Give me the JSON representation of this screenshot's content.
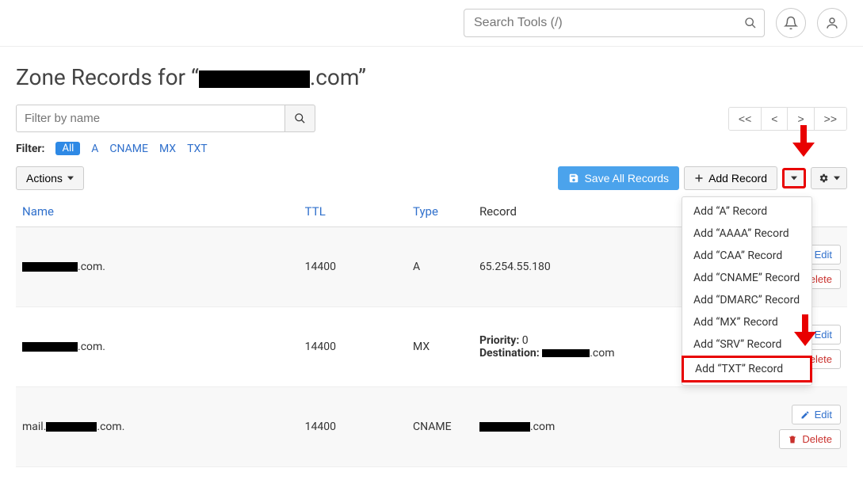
{
  "topbar": {
    "search_placeholder": "Search Tools (/)"
  },
  "title_prefix": "Zone Records for “",
  "title_domain_suffix": ".com",
  "title_close": "”",
  "filter_placeholder": "Filter by name",
  "pager": {
    "first": "<<",
    "prev": "<",
    "next": ">",
    "last": ">>"
  },
  "filters": {
    "label": "Filter:",
    "all": "All",
    "items": [
      "A",
      "CNAME",
      "MX",
      "TXT"
    ]
  },
  "actions_label": "Actions",
  "save_all": "Save All Records",
  "add_record": "Add Record",
  "columns": {
    "name": "Name",
    "ttl": "TTL",
    "type": "Type",
    "record": "Record"
  },
  "rows": [
    {
      "name_suffix": ".com.",
      "ttl": "14400",
      "type": "A",
      "record_text": "65.254.55.180",
      "priority_label": "",
      "priority_val": "",
      "dest_label": "",
      "dest_suffix": ""
    },
    {
      "name_suffix": ".com.",
      "ttl": "14400",
      "type": "MX",
      "record_text": "",
      "priority_label": "Priority:",
      "priority_val": "0",
      "dest_label": "Destination:",
      "dest_suffix": ".com"
    },
    {
      "name_prefix": "mail.",
      "name_suffix": ".com.",
      "ttl": "14400",
      "type": "CNAME",
      "record_text": "",
      "record_suffix": ".com",
      "priority_label": "",
      "priority_val": "",
      "dest_label": "",
      "dest_suffix": ""
    }
  ],
  "row_buttons": {
    "edit": "Edit",
    "delete": "Delete"
  },
  "dropdown": [
    "Add “A” Record",
    "Add “AAAA” Record",
    "Add “CAA” Record",
    "Add “CNAME” Record",
    "Add “DMARC” Record",
    "Add “MX” Record",
    "Add “SRV” Record",
    "Add “TXT” Record"
  ]
}
